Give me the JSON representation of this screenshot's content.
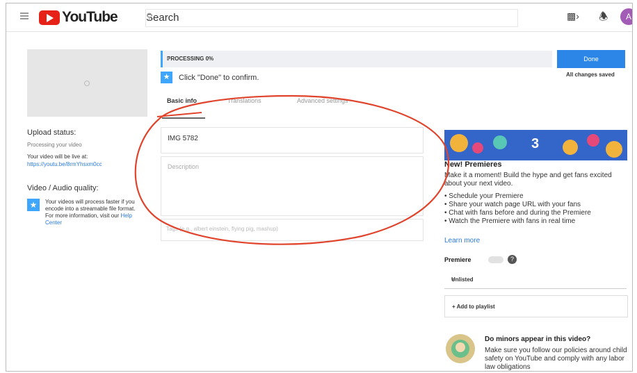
{
  "header": {
    "logo_text": "YouTube",
    "search_placeholder": "Search",
    "search_icon": "search-icon",
    "camera_icon": "video-camera-icon",
    "bell_icon": "bell-icon",
    "avatar_letter": "A",
    "brand_color": "#e62117"
  },
  "upload": {
    "processing_text": "PROCESSING 0%",
    "done_label": "Done",
    "saved_text": "All changes saved",
    "hint_text": "Click \"Done\" to confirm.",
    "tabs": [
      "Basic info",
      "Translations",
      "Advanced settings"
    ],
    "title_value": "IMG 5782",
    "description_placeholder": "Description",
    "tags_placeholder": "Tags (e.g., albert einstein, flying pig, mashup)"
  },
  "left": {
    "upload_status_label": "Upload status:",
    "processing_text": "Processing your video",
    "live_at_text": "Your video will be live at:",
    "video_url": "https://youtu.be/8rmYhsxm0cc",
    "quality_label": "Video / Audio quality:",
    "quality_text": "Your videos will process faster if you encode into a streamable file format. For more information, visit our",
    "help_center_link": "Help Center"
  },
  "premieres": {
    "banner_number": "3",
    "title": "New! Premieres",
    "description": "Make it a moment! Build the hype and get fans excited about your next video.",
    "bullets": [
      "• Schedule your Premiere",
      "• Share your watch page URL with your fans",
      "• Chat with fans before and during the Premiere",
      "• Watch the Premiere with fans in real time"
    ],
    "learn_more": "Learn more",
    "premiere_label": "Premiere",
    "premiere_enabled": false,
    "help_icon": "help-icon",
    "visibility_value": "Unlisted",
    "add_to_playlist": "+ Add to playlist"
  },
  "minors": {
    "title": "Do minors appear in this video?",
    "description": "Make sure you follow our policies around child safety on YouTube and comply with any labor law obligations"
  },
  "annotation": {
    "color": "#e0442c"
  }
}
